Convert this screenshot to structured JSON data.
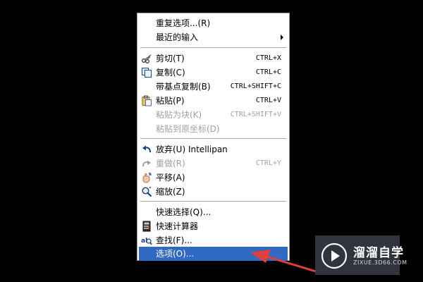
{
  "menu": {
    "items": [
      {
        "label": "重复选项...(R)",
        "shortcut": "",
        "icon": "",
        "submenu": false,
        "disabled": false
      },
      {
        "label": "最近的输入",
        "shortcut": "",
        "icon": "",
        "submenu": true,
        "disabled": false
      },
      {
        "label": "剪切(T)",
        "shortcut": "CTRL+X",
        "icon": "scissors-icon",
        "submenu": false,
        "disabled": false
      },
      {
        "label": "复制(C)",
        "shortcut": "CTRL+C",
        "icon": "copy-icon",
        "submenu": false,
        "disabled": false
      },
      {
        "label": "带基点复制(B)",
        "shortcut": "CTRL+SHIFT+C",
        "icon": "",
        "submenu": false,
        "disabled": false
      },
      {
        "label": "粘贴(P)",
        "shortcut": "CTRL+V",
        "icon": "paste-icon",
        "submenu": false,
        "disabled": false
      },
      {
        "label": "粘贴为块(K)",
        "shortcut": "CTRL+SHIFT+V",
        "icon": "",
        "submenu": false,
        "disabled": true
      },
      {
        "label": "粘贴到原坐标(D)",
        "shortcut": "",
        "icon": "",
        "submenu": false,
        "disabled": true
      },
      {
        "label": "放弃(U) Intellipan",
        "shortcut": "",
        "icon": "undo-icon",
        "submenu": false,
        "disabled": false
      },
      {
        "label": "重做(R)",
        "shortcut": "CTRL+Y",
        "icon": "redo-icon",
        "submenu": false,
        "disabled": true
      },
      {
        "label": "平移(A)",
        "shortcut": "",
        "icon": "pan-hand-icon",
        "submenu": false,
        "disabled": false
      },
      {
        "label": "缩放(Z)",
        "shortcut": "",
        "icon": "zoom-magnifier-icon",
        "submenu": false,
        "disabled": false
      },
      {
        "label": "快速选择(Q)...",
        "shortcut": "",
        "icon": "",
        "submenu": false,
        "disabled": false
      },
      {
        "label": "快速计算器",
        "shortcut": "",
        "icon": "calculator-icon",
        "submenu": false,
        "disabled": false
      },
      {
        "label": "查找(F)...",
        "shortcut": "",
        "icon": "find-text-icon",
        "submenu": false,
        "disabled": false
      },
      {
        "label": "选项(O)...",
        "shortcut": "",
        "icon": "",
        "submenu": false,
        "disabled": false,
        "selected": true
      }
    ]
  },
  "watermark": {
    "title": "溜溜自学",
    "url": "ZIXUE.3D66.COM",
    "logo_icon": "play-triangle-icon"
  },
  "annotation": {
    "arrow_color": "#e0403a"
  },
  "colors": {
    "selection": "#316ac5",
    "disabled_text": "#a0a0a0",
    "background": "#000000"
  }
}
